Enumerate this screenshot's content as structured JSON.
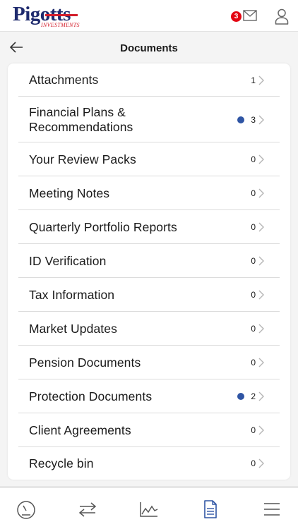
{
  "brand": {
    "name": "Pigotts",
    "tagline": "INVESTMENTS",
    "primary_color": "#1f2b6e",
    "accent_color": "#d31d2a"
  },
  "topbar": {
    "unread_messages": "3",
    "message_icon": "mail-icon",
    "profile_icon": "user-icon"
  },
  "header": {
    "title": "Documents",
    "back_icon": "arrow-left-icon"
  },
  "documents": [
    {
      "label": "Attachments",
      "count": "1",
      "new": false
    },
    {
      "label": "Financial Plans &\nRecommendations",
      "count": "3",
      "new": true
    },
    {
      "label": "Your Review Packs",
      "count": "0",
      "new": false
    },
    {
      "label": "Meeting Notes",
      "count": "0",
      "new": false
    },
    {
      "label": "Quarterly Portfolio Reports",
      "count": "0",
      "new": false
    },
    {
      "label": "ID Verification",
      "count": "0",
      "new": false
    },
    {
      "label": "Tax Information",
      "count": "0",
      "new": false
    },
    {
      "label": "Market Updates",
      "count": "0",
      "new": false
    },
    {
      "label": "Pension Documents",
      "count": "0",
      "new": false
    },
    {
      "label": "Protection Documents",
      "count": "2",
      "new": true
    },
    {
      "label": "Client Agreements",
      "count": "0",
      "new": false
    },
    {
      "label": "Recycle bin",
      "count": "0",
      "new": false
    }
  ],
  "tabs": [
    {
      "icon": "dashboard-gauge-icon",
      "active": false
    },
    {
      "icon": "transactions-arrows-icon",
      "active": false
    },
    {
      "icon": "performance-chart-icon",
      "active": false
    },
    {
      "icon": "documents-icon",
      "active": true
    },
    {
      "icon": "menu-icon",
      "active": false
    }
  ],
  "colors": {
    "new_dot": "#2f55a4",
    "badge": "#e30613",
    "tab_active": "#2f55a4",
    "tab_inactive": "#555555"
  }
}
